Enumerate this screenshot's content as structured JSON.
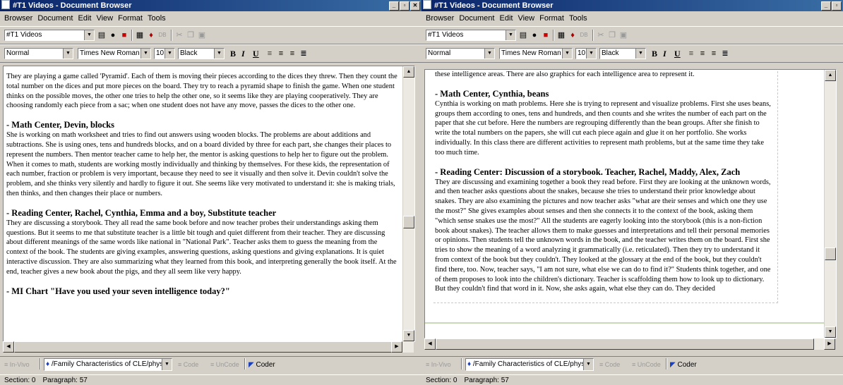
{
  "left": {
    "title": "#T1 Videos - Document Browser",
    "menu": [
      "Browser",
      "Document",
      "Edit",
      "View",
      "Format",
      "Tools"
    ],
    "doc_select": "#T1 Videos",
    "style_select": "Normal",
    "font_select": "Times New Roman",
    "size_select": "10",
    "color_select": "Black",
    "doc_paragraphs": [
      {
        "heading": "",
        "text": "They are playing a game called 'Pyramid'. Each of them is moving their pieces according to the dices they threw. Then they count the total number on the dices and put more pieces on the board. They try to reach a pyramid shape to finish the game. When one student thinks on the possible moves, the other one tries to help the other one, so it seems like they are playing cooperatively. They are choosing randomly each piece from a sac; when one student does not have any move, passes the dices to the other one."
      },
      {
        "heading": "- Math Center, Devin, blocks",
        "text": "She is working on math worksheet and tries to find out answers using wooden blocks. The problems are about additions and subtractions. She is using ones, tens and hundreds blocks, and on a board divided by three for each part, she changes their places to represent the numbers. Then mentor teacher came to help her, the mentor is asking questions to help her to figure out the problem. When it comes to math, students are working mostly individually and thinking by themselves. For these kids, the representation of each number, fraction or problem is very important, because they need to see it visually and then solve it. Devin couldn't solve the problem, and she thinks very silently and hardly to figure it out. She seems like very motivated to understand it: she is making trials, then thinks, and then changes their place or numbers."
      },
      {
        "heading": "- Reading Center, Rachel, Cynthia, Emma and a boy, Substitute teacher",
        "text": "They are discussing a storybook. They all read the same book before and now teacher probes their understandings asking them questions. But it seems to me that substitute teacher is a little bit tough and quiet different from their teacher. They are discussing about different meanings of the same words like national in \"National Park\". Teacher asks them to guess the meaning from the context of the book. The students are giving examples, answering questions, asking questions and giving explanations. It is quiet interactive discussion. They are also summarizing what they learned from this book, and interpreting generally the book itself. At the end, teacher gives a new book about the pigs, and they all seem like very happy."
      },
      {
        "heading": "- MI Chart \"Have you used your seven intelligence today?\"",
        "text": ""
      }
    ],
    "code_toolbar": {
      "invivo": "In-Vivo",
      "code_path": "/Family Characteristics of CLE/physical",
      "code": "Code",
      "uncode": "UnCode",
      "coder": "Coder"
    },
    "status": {
      "section": "Section: 0",
      "paragraph": "Paragraph: 57"
    }
  },
  "right": {
    "title": "#T1 Videos - Document Browser",
    "menu": [
      "Browser",
      "Document",
      "Edit",
      "View",
      "Format",
      "Tools"
    ],
    "doc_select": "#T1 Videos",
    "style_select": "Normal",
    "font_select": "Times New Roman",
    "size_select": "10",
    "color_select": "Black",
    "doc_paragraphs": [
      {
        "heading": "",
        "text": "these intelligence areas. There are also graphics for each intelligence area to represent it."
      },
      {
        "heading": "- Math Center, Cynthia, beans",
        "text": "Cynthia is working on math problems. Here she is trying to represent and visualize problems. First she uses beans, groups them according to ones, tens and hundreds, and then counts and she writes the number of each part on the paper that she cut before. Here the numbers are regrouping differently than the bean groups. After she finish to write the total numbers on the papers, she will cut each piece again and glue it on her portfolio. She works individually. In this class there are different activities to represent math problems, but at the same time they take too much time."
      },
      {
        "heading": "- Reading Center: Discussion of a storybook. Teacher, Rachel, Maddy, Alex, Zach",
        "text": "They are discussing and examining together a book they read before. First they are looking at the unknown words, and then teacher asks questions about the snakes, because she tries to understand their prior knowledge about snakes. They are also examining the pictures and now teacher asks \"what are their senses and which one they use the most?\" She gives examples about senses and then she connects it to the context of the book, asking them \"which sense snakes use the most?\" All the students are eagerly looking into the storybook (this is a non-fiction book about snakes). The teacher allows them to make guesses and interpretations and tell their personal memories or opinions. Then students tell the unknown words in the book, and the teacher writes them on the board. First she tries to show the meaning of a word analyzing it grammatically (i.e. reticulated). Then they try to understand it from context of the book but they couldn't. They looked at the glossary at the end of the book, but they couldn't find there, too. Now, teacher says, \"I am not sure, what else we can do to find it?\" Students think together, and one of them proposes to look into the children's dictionary. Teacher is scaffolding them how to look up to dictionary. But they couldn't find that word in it. Now, she asks again, what else they can do. They decided"
      }
    ],
    "code_toolbar": {
      "invivo": "In-Vivo",
      "code_path": "/Family Characteristics of CLE/physical",
      "code": "Code",
      "uncode": "UnCode",
      "coder": "Coder"
    },
    "status": {
      "section": "Section: 0",
      "paragraph": "Paragraph: 57"
    }
  }
}
